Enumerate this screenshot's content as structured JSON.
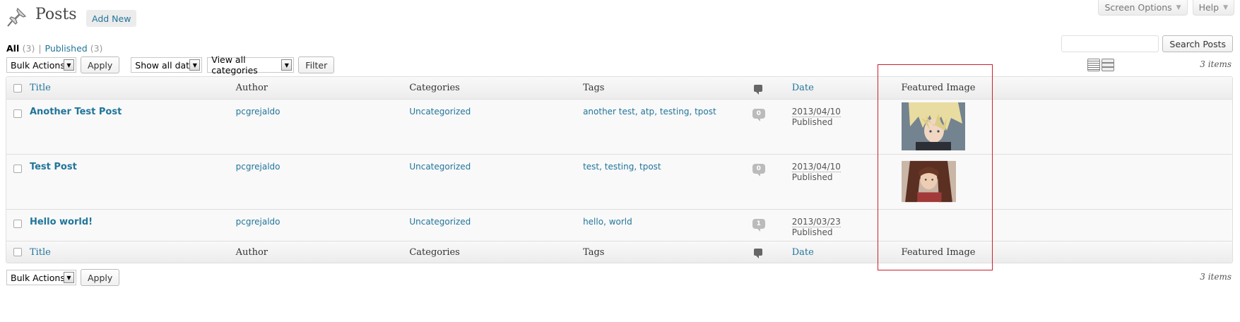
{
  "screen_meta": {
    "screen_options": "Screen Options",
    "help": "Help"
  },
  "header": {
    "title": "Posts",
    "add_new": "Add New"
  },
  "filters": {
    "all_label": "All",
    "all_count": "(3)",
    "published_label": "Published",
    "published_count": "(3)"
  },
  "search": {
    "button": "Search Posts",
    "value": ""
  },
  "tablenav_top": {
    "bulk_actions": "Bulk Actions",
    "apply": "Apply",
    "dates": "Show all dates",
    "categories": "View all categories",
    "filter": "Filter"
  },
  "tablenav_bottom": {
    "bulk_actions": "Bulk Actions",
    "apply": "Apply"
  },
  "items_count": "3 items",
  "columns": {
    "title": "Title",
    "author": "Author",
    "categories": "Categories",
    "tags": "Tags",
    "date": "Date",
    "featured_image": "Featured Image"
  },
  "posts": [
    {
      "title": "Another Test Post",
      "author": "pcgrejaldo",
      "categories": "Uncategorized",
      "tags": [
        "another test",
        "atp",
        "testing",
        "tpost"
      ],
      "comments": "0",
      "date": "2013/04/10",
      "status": "Published",
      "featured_image": "blond-haired character portrait"
    },
    {
      "title": "Test Post",
      "author": "pcgrejaldo",
      "categories": "Uncategorized",
      "tags": [
        "test",
        "testing",
        "tpost"
      ],
      "comments": "0",
      "date": "2013/04/10",
      "status": "Published",
      "featured_image": "brown-haired character portrait"
    },
    {
      "title": "Hello world!",
      "author": "pcgrejaldo",
      "categories": "Uncategorized",
      "tags": [
        "hello",
        "world"
      ],
      "comments": "1",
      "date": "2013/03/23",
      "status": "Published",
      "featured_image": ""
    }
  ],
  "colors": {
    "link": "#21759b",
    "highlight_box": "#cc1f2b"
  }
}
